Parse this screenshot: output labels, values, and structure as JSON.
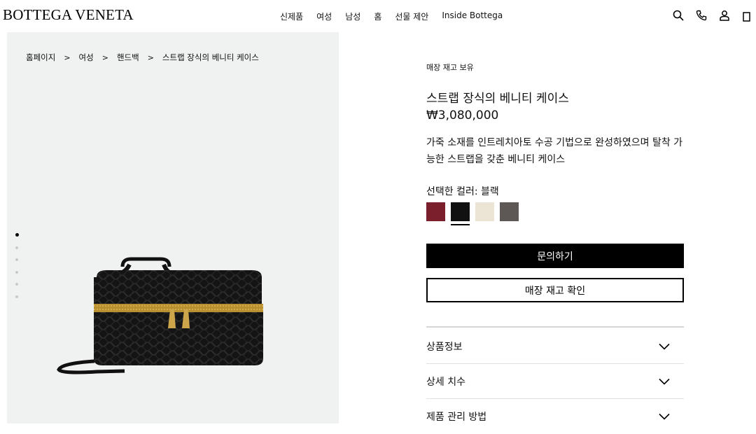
{
  "header": {
    "logo": "BOTTEGA VENETA",
    "nav": [
      "신제품",
      "여성",
      "남성",
      "홈",
      "선물 제안",
      "Inside Bottega"
    ],
    "icons": [
      "search-icon",
      "phone-icon",
      "account-icon",
      "bag-icon"
    ]
  },
  "breadcrumb": [
    "홈페이지",
    "여성",
    "핸드백",
    "스트랩 장식의 베니티 케이스"
  ],
  "breadcrumb_separator": ">",
  "gallery": {
    "image_count": 6,
    "active_index": 0
  },
  "product": {
    "stock_status": "매장 재고 보유",
    "title": "스트랩 장식의 베니티 케이스",
    "price": "₩3,080,000",
    "description": "가죽 소재를 인트레치아토 수공 기법으로 완성하였으며 탈착 가능한 스트랩을 갖춘 베니티 케이스",
    "color_label": "선택한 컬러: 블랙",
    "swatch_colors": [
      "#7a1f2b",
      "#111111",
      "#ece4d4",
      "#5d5855"
    ],
    "selected_swatch": 1,
    "inquire_button": "문의하기",
    "store_stock_button": "매장 재고 확인"
  },
  "accordion": [
    "상품정보",
    "상세 치수",
    "제품 관리 방법"
  ]
}
